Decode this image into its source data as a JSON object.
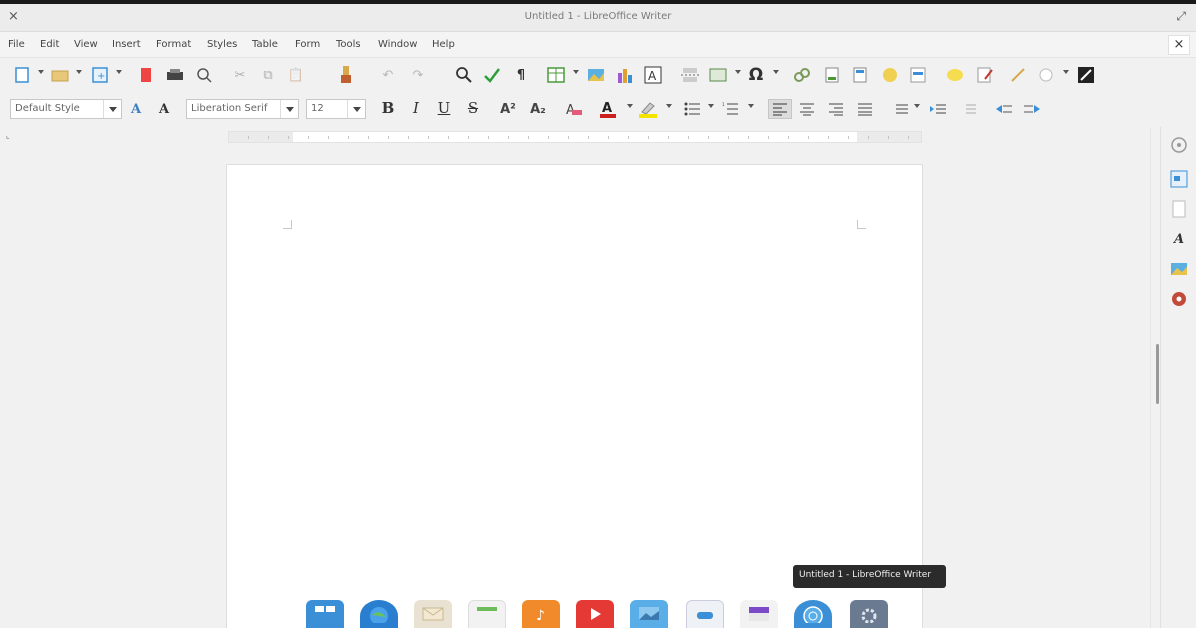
{
  "window": {
    "title": "Untitled 1 - LibreOffice Writer",
    "close_glyph": "×",
    "maximize_glyph": "⤢"
  },
  "menu": {
    "items": [
      "File",
      "Edit",
      "View",
      "Insert",
      "Format",
      "Styles",
      "Table",
      "Form",
      "Tools",
      "Window",
      "Help"
    ],
    "close_document_glyph": "×"
  },
  "formatting": {
    "paragraph_style": "Default Style",
    "font_name": "Liberation Serif",
    "font_size": "12",
    "bold_label": "B",
    "italic_label": "I",
    "underline_label": "U",
    "strikethrough_label": "S"
  },
  "toolbar_icons": {
    "new": "new-document-icon",
    "open": "open-folder-icon",
    "save": "save-icon",
    "export_pdf": "export-pdf-icon",
    "print": "print-icon",
    "print_preview": "print-preview-icon",
    "cut": "cut-icon",
    "copy": "copy-icon",
    "paste": "paste-icon",
    "clone": "clone-formatting-icon",
    "undo": "undo-icon",
    "redo": "redo-icon",
    "find": "find-replace-icon",
    "spelling": "spelling-icon",
    "formatting_marks": "formatting-marks-icon",
    "table": "insert-table-icon",
    "image": "insert-image-icon",
    "chart": "insert-chart-icon",
    "textbox": "insert-textbox-icon",
    "page_break": "page-break-icon",
    "field": "insert-field-icon",
    "special_char": "special-character-icon",
    "hyperlink": "hyperlink-icon",
    "footnote": "footnote-icon",
    "endnote": "endnote-icon",
    "bookmark": "bookmark-icon",
    "cross_ref": "cross-reference-icon",
    "comment": "comment-icon",
    "track_changes": "track-changes-icon",
    "line": "insert-line-icon",
    "shapes": "basic-shapes-icon",
    "draw": "draw-functions-icon"
  },
  "sidebar_icons": [
    "properties-icon",
    "page-icon",
    "styles-icon",
    "gallery-icon",
    "navigator-icon"
  ],
  "taskbar": {
    "tooltip": "Untitled 1 - LibreOffice Writer",
    "apps": [
      "multitasking-view-icon",
      "web-browser-icon",
      "mail-icon",
      "calendar-icon",
      "music-icon",
      "videos-icon",
      "photos-icon",
      "switchboard-icon",
      "appcenter-icon",
      "epiphany-icon",
      "system-settings-icon"
    ]
  },
  "colors": {
    "font_color": "#cc1f1f",
    "highlight_color": "#f5e400",
    "accent_blue": "#3b8fd6"
  }
}
